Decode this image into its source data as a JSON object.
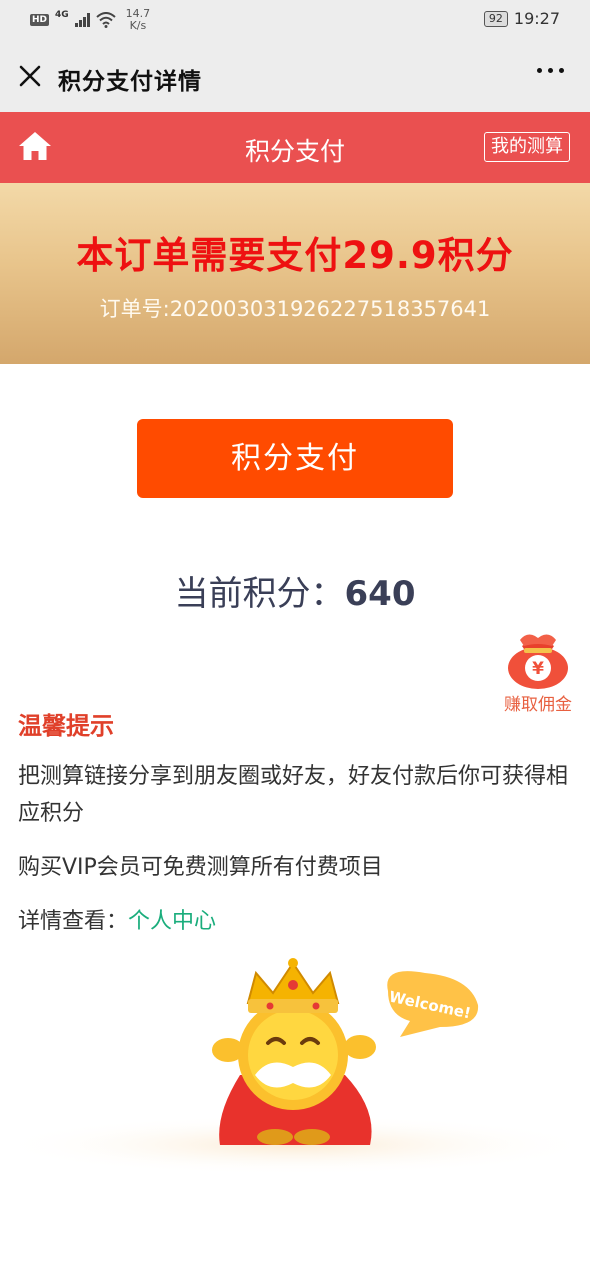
{
  "status_bar": {
    "hd": "HD",
    "network": "4G",
    "speed_value": "14.7",
    "speed_unit": "K/s",
    "battery": "92",
    "time": "19:27"
  },
  "topbar": {
    "title": "积分支付详情"
  },
  "header": {
    "title": "积分支付",
    "my_calc_label": "我的测算"
  },
  "banner": {
    "amount_text": "本订单需要支付29.9积分",
    "order_number": "订单号:20200303192622751835764​1"
  },
  "pay_button_label": "积分支付",
  "points": {
    "label": "当前积分：",
    "value": "640"
  },
  "earn_commission": {
    "label": "赚取佣金",
    "symbol": "¥"
  },
  "tips": {
    "title": "温馨提示",
    "line1": "把测算链接分享到朋友圈或好友，好友付款后你可获得相应积分",
    "line2": "购买VIP会员可免费测算所有付费项目",
    "line3_prefix": "详情查看：",
    "line3_link": "个人中心"
  },
  "mascot": {
    "bubble_text": "Welcome!"
  },
  "colors": {
    "header_red": "#ea5050",
    "pay_orange": "#ff4b00",
    "amount_red": "#ee1111",
    "link_green": "#1aad7c"
  }
}
